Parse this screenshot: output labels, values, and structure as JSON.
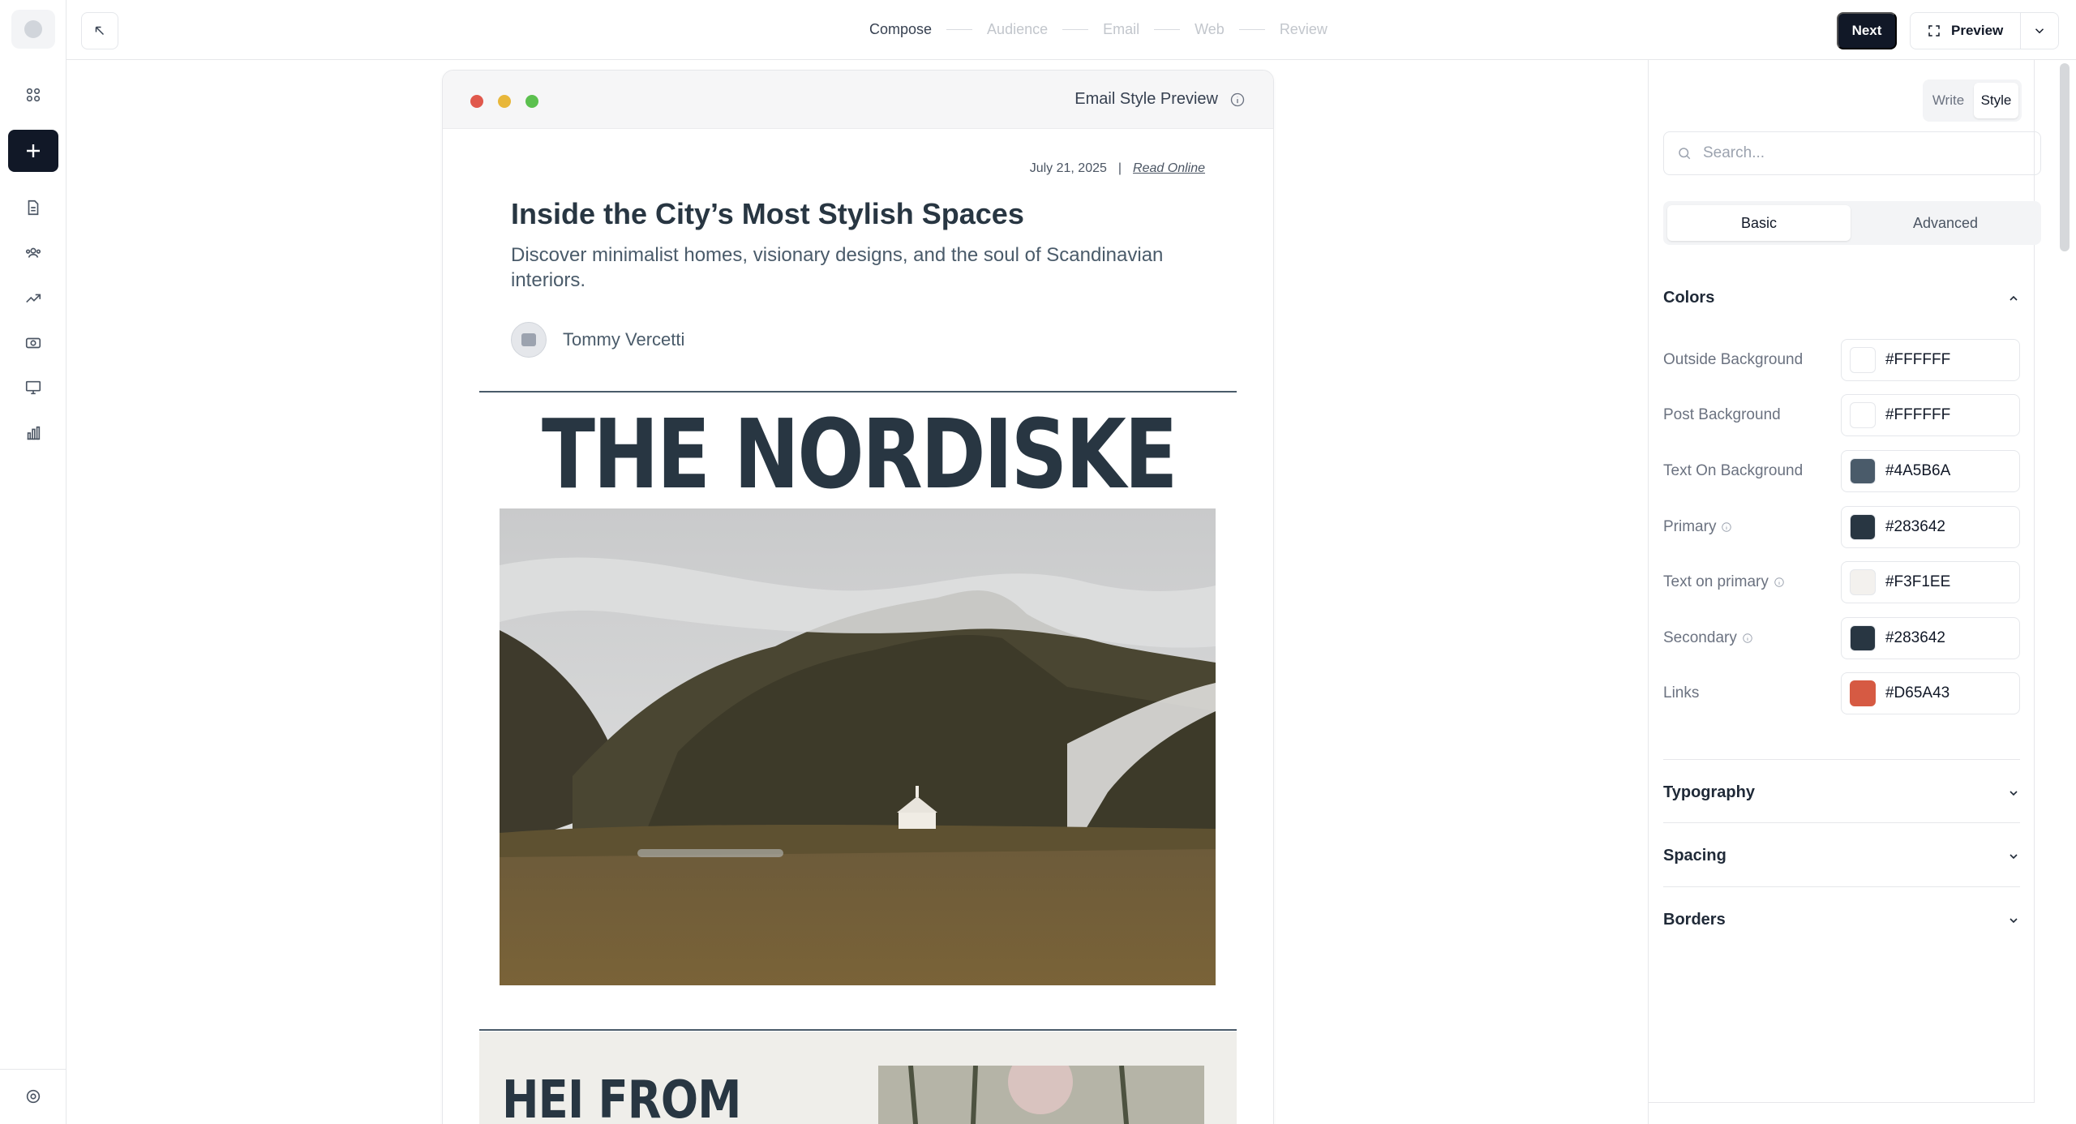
{
  "steps": [
    "Compose",
    "Audience",
    "Email",
    "Web",
    "Review"
  ],
  "active_step": "Compose",
  "header": {
    "next_label": "Next",
    "preview_label": "Preview"
  },
  "frame": {
    "title": "Email Style Preview"
  },
  "email": {
    "date": "July 21, 2025",
    "separator": "|",
    "read_online": "Read Online",
    "headline": "Inside the City’s Most Stylish Spaces",
    "subheadline": "Discover minimalist homes, visionary designs, and the soul of Scandinavian interiors.",
    "author": "Tommy Vercetti",
    "brand": "THE NORDISKE",
    "section2_title": "HEI FROM"
  },
  "panel": {
    "mode_tabs": [
      "Write",
      "Style"
    ],
    "active_mode": "Style",
    "search_placeholder": "Search...",
    "segments": [
      "Basic",
      "Advanced"
    ],
    "active_segment": "Basic",
    "colors_title": "Colors",
    "colors": [
      {
        "label": "Outside Background",
        "value": "#FFFFFF",
        "info": false
      },
      {
        "label": "Post Background",
        "value": "#FFFFFF",
        "info": false
      },
      {
        "label": "Text On Background",
        "value": "#4A5B6A",
        "info": false
      },
      {
        "label": "Primary",
        "value": "#283642",
        "info": true
      },
      {
        "label": "Text on primary",
        "value": "#F3F1EE",
        "info": true
      },
      {
        "label": "Secondary",
        "value": "#283642",
        "info": true
      },
      {
        "label": "Links",
        "value": "#D65A43",
        "info": false
      }
    ],
    "sections": [
      "Typography",
      "Spacing",
      "Borders"
    ]
  },
  "icons": {
    "sidebar": [
      "logo-icon",
      "apps-grid-icon",
      "plus-icon",
      "document-icon",
      "audience-icon",
      "trend-icon",
      "money-icon",
      "monitor-icon",
      "bar-chart-icon",
      "settings-icon"
    ],
    "traffic_colors": [
      "#E0584C",
      "#E8B73A",
      "#5CC04F"
    ]
  }
}
